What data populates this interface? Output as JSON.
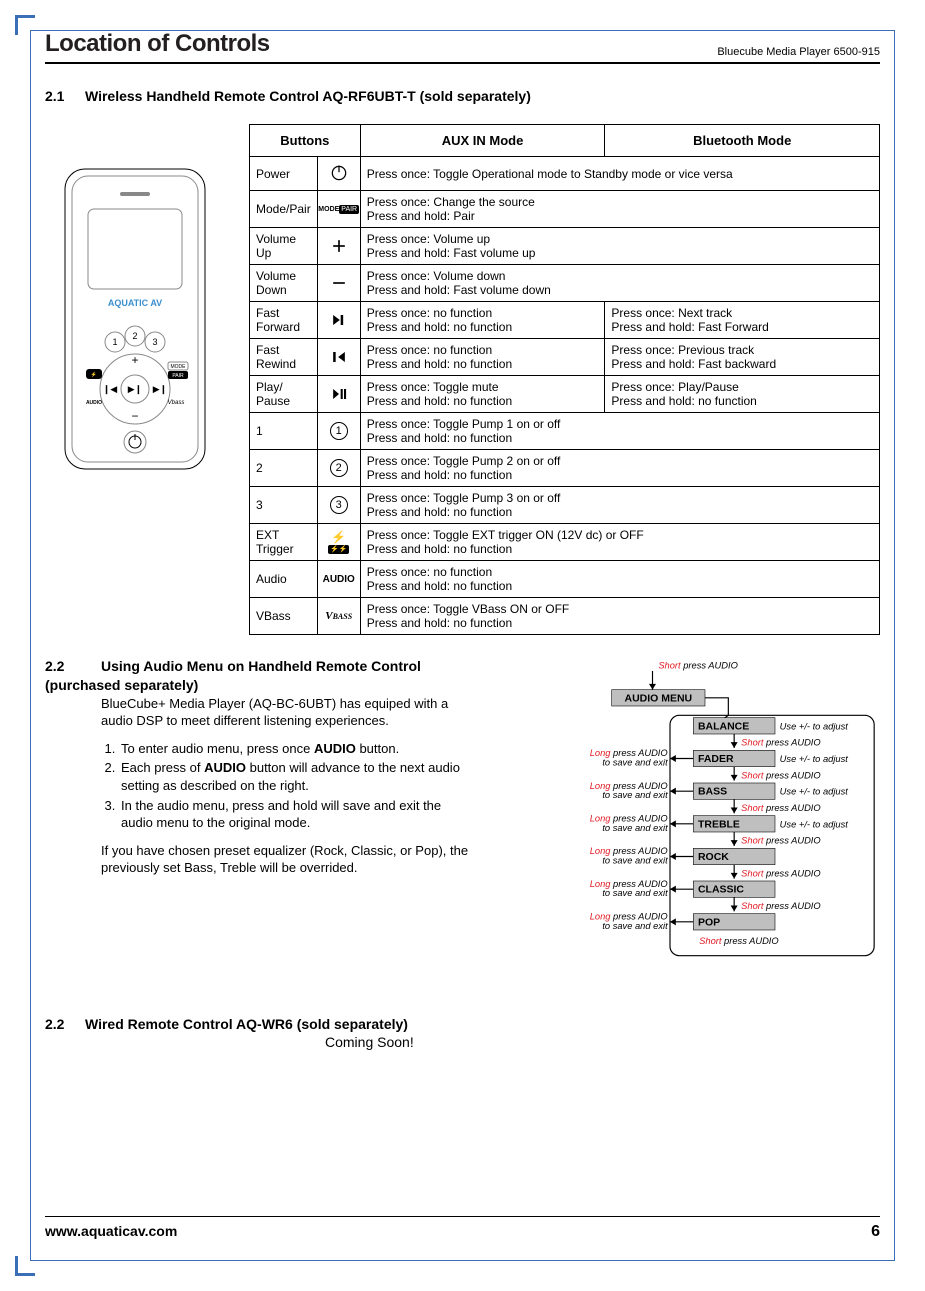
{
  "header": {
    "title": "Location of Controls",
    "product": "Bluecube Media Player 6500-915"
  },
  "section21": {
    "num": "2.1",
    "title": "Wireless Handheld Remote Control AQ-RF6UBT-T (sold separately)"
  },
  "table": {
    "headers": {
      "buttons": "Buttons",
      "aux": "AUX IN Mode",
      "bt": "Bluetooth Mode"
    },
    "rows": [
      {
        "name": "Power",
        "icon": "power",
        "desc_full": "Press once: Toggle Operational mode to Standby mode or vice versa"
      },
      {
        "name": "Mode/Pair",
        "icon": "modepair",
        "desc_full": "Press once: Change the source\nPress and hold: Pair"
      },
      {
        "name": "Volume Up",
        "icon": "plus",
        "desc_full": "Press once: Volume up\nPress and hold: Fast volume up"
      },
      {
        "name": "Volume Down",
        "icon": "minus",
        "desc_full": "Press once: Volume down\nPress and hold: Fast volume down"
      },
      {
        "name": "Fast Forward",
        "icon": "ffwd",
        "aux": "Press once: no function\nPress and hold: no function",
        "bt": "Press once: Next track\nPress and hold: Fast Forward"
      },
      {
        "name": "Fast Rewind",
        "icon": "frwd",
        "aux": "Press once: no function\nPress and hold: no function",
        "bt": "Press once: Previous track\nPress and hold: Fast backward"
      },
      {
        "name": "Play/ Pause",
        "icon": "playpause",
        "aux": "Press once: Toggle mute\nPress and hold: no function",
        "bt": "Press once: Play/Pause\nPress and hold: no function"
      },
      {
        "name": "1",
        "icon": "c1",
        "desc_full": "Press once: Toggle Pump 1 on or off\nPress and hold: no function"
      },
      {
        "name": "2",
        "icon": "c2",
        "desc_full": "Press once: Toggle Pump 2 on or off\nPress and hold: no function"
      },
      {
        "name": "3",
        "icon": "c3",
        "desc_full": "Press once: Toggle Pump 3 on or off\nPress and hold: no function"
      },
      {
        "name": "EXT Trigger",
        "icon": "ext",
        "desc_full": "Press once: Toggle EXT trigger ON (12V dc) or OFF\nPress and hold: no function"
      },
      {
        "name": "Audio",
        "icon": "audio",
        "desc_full": "Press once: no function\nPress and hold: no function"
      },
      {
        "name": "VBass",
        "icon": "vbass",
        "desc_full": "Press once: Toggle VBass ON or OFF\nPress and hold: no function"
      }
    ]
  },
  "section22": {
    "num": "2.2",
    "title": "Using Audio Menu on Handheld Remote Control (purchased separately)",
    "intro": "BlueCube+ Media Player (AQ-BC-6UBT) has equiped with a audio DSP to meet different listening experiences.",
    "steps": [
      {
        "pre": "To enter audio menu, press once ",
        "bold": "AUDIO",
        "post": " button."
      },
      {
        "pre": "Each press of ",
        "bold": "AUDIO",
        "post": " button will advance to the next audio setting as described on the right."
      },
      {
        "pre": "In the audio menu, press and hold will save and exit the audio menu to the original mode.",
        "bold": "",
        "post": ""
      }
    ],
    "note": "If you have chosen preset equalizer (Rock, Classic, or Pop), the previously set Bass, Treble will be overrided."
  },
  "flow": {
    "top": "Short press AUDIO",
    "root": "AUDIO MENU",
    "items": [
      {
        "label": "BALANCE",
        "right": "Use +/-  to adjust"
      },
      {
        "label": "FADER",
        "right": "Use +/-  to adjust"
      },
      {
        "label": "BASS",
        "right": "Use +/- to adjust"
      },
      {
        "label": "TREBLE",
        "right": "Use +/- to adjust"
      },
      {
        "label": "ROCK",
        "right": ""
      },
      {
        "label": "CLASSIC",
        "right": ""
      },
      {
        "label": "POP",
        "right": ""
      }
    ],
    "short_label": "Short press AUDIO",
    "short_label_pre": "Short",
    "short_label_post": " press AUDIO",
    "long_label_pre": "Long",
    "long_label_mid": " press AUDIO",
    "long_label_sub": "to save and exit"
  },
  "section23": {
    "num": "2.2",
    "title": "Wired Remote Control AQ-WR6 (sold separately)",
    "body": "Coming Soon!"
  },
  "footer": {
    "url": "www.aquaticav.com",
    "page": "6"
  },
  "remote_brand": "AQUATIC AV"
}
